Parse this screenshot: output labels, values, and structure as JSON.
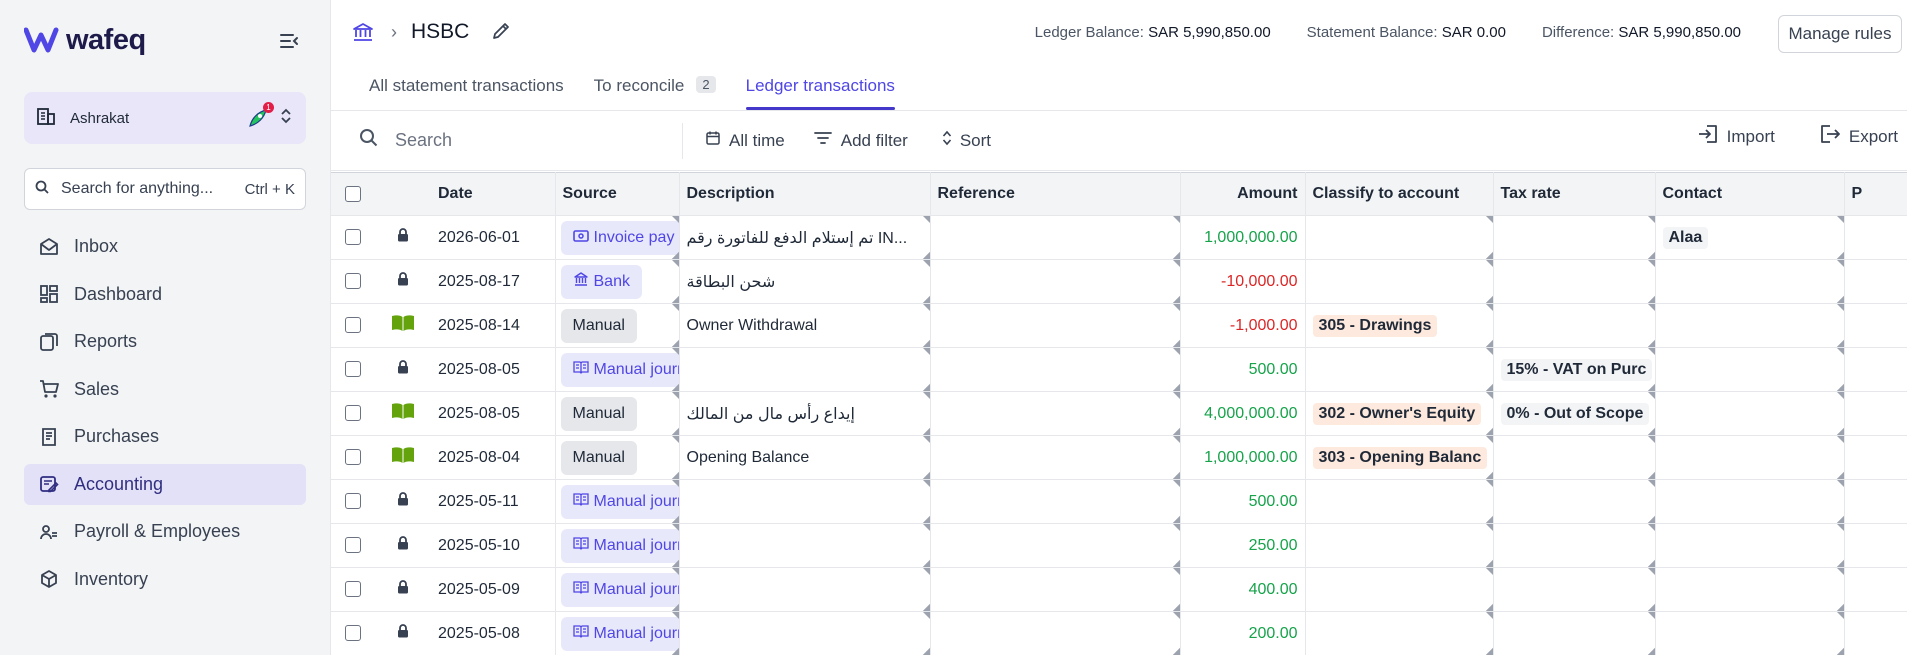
{
  "sidebar": {
    "brand": "wafeq",
    "org_name": "Ashrakat",
    "notification_count": "1",
    "search_placeholder": "Search for anything...",
    "search_shortcut": "Ctrl + K",
    "items": [
      {
        "label": "Inbox",
        "icon": "inbox-icon",
        "active": false
      },
      {
        "label": "Dashboard",
        "icon": "dashboard-icon",
        "active": false
      },
      {
        "label": "Reports",
        "icon": "reports-icon",
        "active": false
      },
      {
        "label": "Sales",
        "icon": "cart-icon",
        "active": false
      },
      {
        "label": "Purchases",
        "icon": "receipt-icon",
        "active": false
      },
      {
        "label": "Accounting",
        "icon": "accounting-icon",
        "active": true
      },
      {
        "label": "Payroll & Employees",
        "icon": "people-icon",
        "active": false
      },
      {
        "label": "Inventory",
        "icon": "box-icon",
        "active": false
      }
    ]
  },
  "header": {
    "account": "HSBC",
    "ledger_label": "Ledger Balance:",
    "ledger_value": "SAR 5,990,850.00",
    "statement_label": "Statement Balance:",
    "statement_value": "SAR 0.00",
    "difference_label": "Difference:",
    "difference_value": "SAR 5,990,850.00",
    "manage_rules": "Manage rules"
  },
  "tabs": [
    {
      "label": "All statement transactions",
      "count": "",
      "active": false
    },
    {
      "label": "To reconcile",
      "count": "2",
      "active": false
    },
    {
      "label": "Ledger transactions",
      "count": "",
      "active": true
    }
  ],
  "toolbar": {
    "search_placeholder": "Search",
    "date_filter": "All time",
    "add_filter": "Add filter",
    "sort": "Sort",
    "import": "Import",
    "export": "Export"
  },
  "table": {
    "columns": [
      "Date",
      "Source",
      "Description",
      "Reference",
      "Amount",
      "Classify to account",
      "Tax rate",
      "Contact",
      "P"
    ],
    "rows": [
      {
        "status": "lock",
        "date": "2026-06-01",
        "source": "Invoice pay",
        "source_type": "invoice",
        "description": "تم إستلام الدفع للفاتورة رقم IN...",
        "reference": "",
        "amount": "1,000,000.00",
        "sign": "pos",
        "account": "",
        "tax": "",
        "contact": "Alaa"
      },
      {
        "status": "lock",
        "date": "2025-08-17",
        "source": "Bank",
        "source_type": "bank",
        "description": "شحن البطاقة",
        "reference": "",
        "amount": "-10,000.00",
        "sign": "neg",
        "account": "",
        "tax": "",
        "contact": ""
      },
      {
        "status": "book",
        "date": "2025-08-14",
        "source": "Manual",
        "source_type": "manual",
        "description": "Owner Withdrawal",
        "reference": "",
        "amount": "-1,000.00",
        "sign": "neg",
        "account": "305 - Drawings",
        "tax": "",
        "contact": ""
      },
      {
        "status": "lock",
        "date": "2025-08-05",
        "source": "Manual journ",
        "source_type": "journal",
        "description": "",
        "reference": "",
        "amount": "500.00",
        "sign": "pos",
        "account": "",
        "tax": "15% - VAT on Purc",
        "contact": ""
      },
      {
        "status": "book",
        "date": "2025-08-05",
        "source": "Manual",
        "source_type": "manual",
        "description": "إيداع رأس مال من المالك",
        "reference": "",
        "amount": "4,000,000.00",
        "sign": "pos",
        "account": "302 - Owner's Equity",
        "tax": "0% - Out of Scope",
        "contact": ""
      },
      {
        "status": "book",
        "date": "2025-08-04",
        "source": "Manual",
        "source_type": "manual",
        "description": "Opening Balance",
        "reference": "",
        "amount": "1,000,000.00",
        "sign": "pos",
        "account": "303 - Opening Balanc",
        "tax": "",
        "contact": ""
      },
      {
        "status": "lock",
        "date": "2025-05-11",
        "source": "Manual journ",
        "source_type": "journal",
        "description": "",
        "reference": "",
        "amount": "500.00",
        "sign": "pos",
        "account": "",
        "tax": "",
        "contact": ""
      },
      {
        "status": "lock",
        "date": "2025-05-10",
        "source": "Manual journ",
        "source_type": "journal",
        "description": "",
        "reference": "",
        "amount": "250.00",
        "sign": "pos",
        "account": "",
        "tax": "",
        "contact": ""
      },
      {
        "status": "lock",
        "date": "2025-05-09",
        "source": "Manual journ",
        "source_type": "journal",
        "description": "",
        "reference": "",
        "amount": "400.00",
        "sign": "pos",
        "account": "",
        "tax": "",
        "contact": ""
      },
      {
        "status": "lock",
        "date": "2025-05-08",
        "source": "Manual journ",
        "source_type": "journal",
        "description": "",
        "reference": "",
        "amount": "200.00",
        "sign": "pos",
        "account": "",
        "tax": "",
        "contact": ""
      }
    ]
  },
  "colors": {
    "accent": "#4f46e5",
    "positive": "#16a34a",
    "negative": "#dc2626",
    "book_icon": "#65a30d"
  }
}
